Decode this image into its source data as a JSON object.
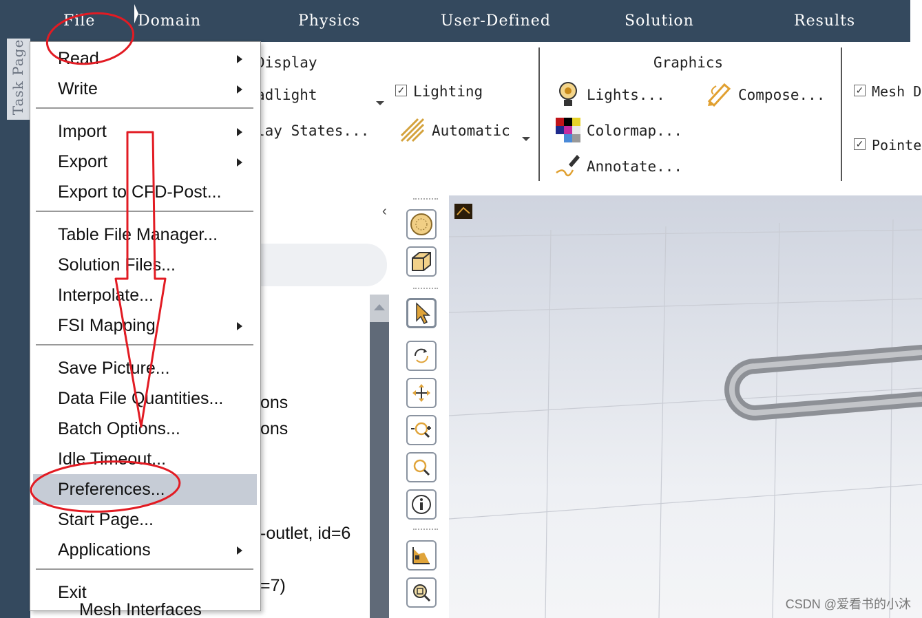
{
  "menubar": {
    "file": "File",
    "domain": "Domain",
    "physics": "Physics",
    "user_defined": "User-Defined",
    "solution": "Solution",
    "results": "Results"
  },
  "task_page": "Task Page",
  "ribbon": {
    "display_group": "Display",
    "headlight": "adlight",
    "display_states": "lay States...",
    "lighting": "Lighting",
    "automatic": "Automatic",
    "graphics_group": "Graphics",
    "lights": "Lights...",
    "compose": "Compose...",
    "colormap": "Colormap...",
    "annotate": "Annotate...",
    "mesh": "Mesh D",
    "pointer": "Pointe"
  },
  "tree": {
    "item1": "ons",
    "item2": "ons",
    "item3": "-outlet, id=6",
    "item4": "=7)",
    "item5": "Mesh Interfaces"
  },
  "file_menu": {
    "read": "Read",
    "write": "Write",
    "import": "Import",
    "export": "Export",
    "export_cfd": "Export to CFD-Post...",
    "table_file_manager": "Table File Manager...",
    "solution_files": "Solution Files...",
    "interpolate": "Interpolate...",
    "fsi_mapping": "FSI Mapping",
    "save_picture": "Save Picture...",
    "data_file_quantities": "Data File Quantities...",
    "batch_options": "Batch Options...",
    "idle_timeout": "Idle Timeout...",
    "preferences": "Preferences...",
    "start_page": "Start Page...",
    "applications": "Applications",
    "exit": "Exit"
  },
  "watermark": "CSDN @爱看书的小沐",
  "colors": {
    "menubar": "#34495e",
    "highlight": "#c6ccd6",
    "annotation": "#e21b23"
  },
  "icons": [
    "lights-icon",
    "compose-icon",
    "colormap-icon",
    "annotate-icon",
    "automatic-icon",
    "fit-icon",
    "view-icon",
    "select-icon",
    "rotate-icon",
    "pan-icon",
    "zoom-in-icon",
    "zoom-icon",
    "probe-icon",
    "legend-icon",
    "zoom-box-icon"
  ]
}
